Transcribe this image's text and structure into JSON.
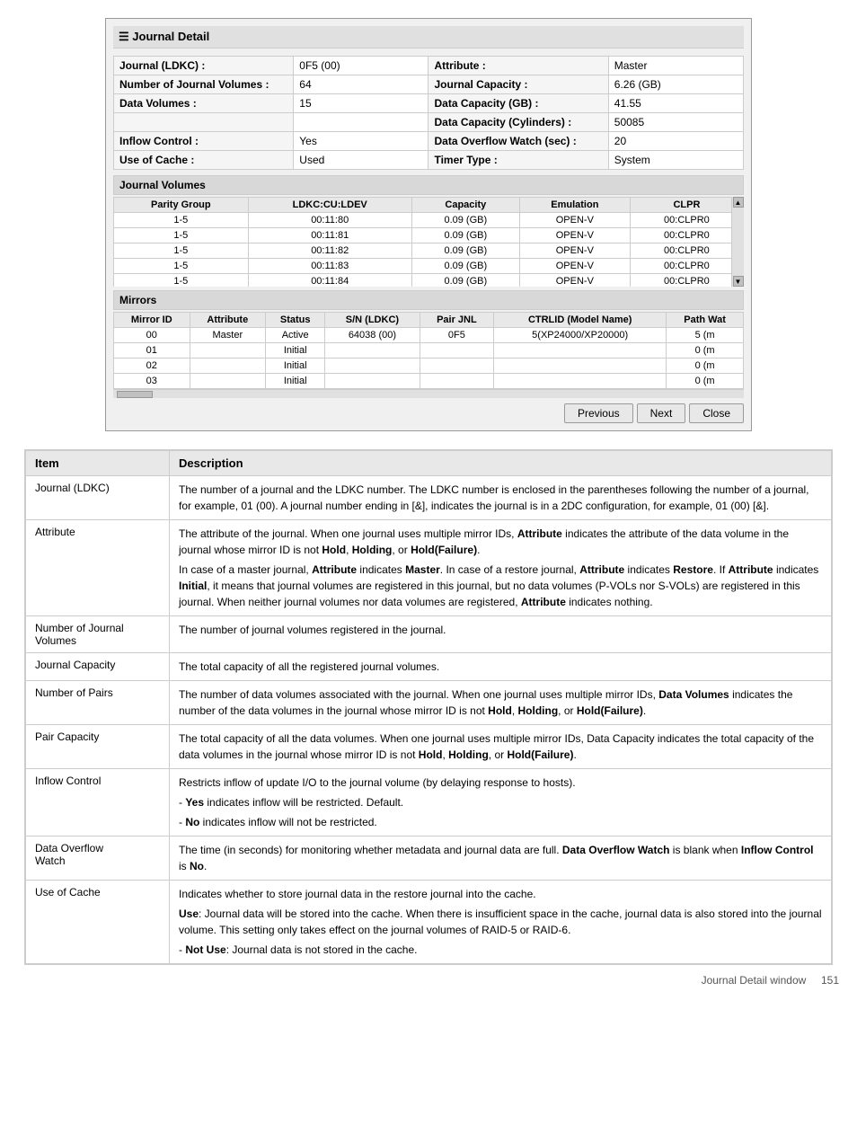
{
  "dialog": {
    "title": "Journal Detail",
    "fields": [
      {
        "label": "Journal (LDKC) :",
        "value": "0F5 (00)",
        "label2": "Attribute :",
        "value2": "Master"
      },
      {
        "label": "Number of Journal Volumes :",
        "value": "64",
        "label2": "Journal Capacity :",
        "value2": "6.26 (GB)"
      },
      {
        "label": "Data Volumes :",
        "value": "15",
        "label2": "Data Capacity (GB) :",
        "value2": "41.55"
      },
      {
        "label": "",
        "value": "",
        "label2": "Data Capacity (Cylinders) :",
        "value2": "50085"
      },
      {
        "label": "Inflow Control :",
        "value": "Yes",
        "label2": "Data Overflow Watch (sec) :",
        "value2": "20"
      },
      {
        "label": "Use of Cache :",
        "value": "Used",
        "label2": "Timer Type :",
        "value2": "System"
      }
    ],
    "journal_volumes_title": "Journal Volumes",
    "journal_volumes_headers": [
      "Parity Group",
      "LDKC:CU:LDEV",
      "Capacity",
      "Emulation",
      "CLPR"
    ],
    "journal_volumes_rows": [
      [
        "1-5",
        "00:11:80",
        "0.09 (GB)",
        "OPEN-V",
        "00:CLPR0"
      ],
      [
        "1-5",
        "00:11:81",
        "0.09 (GB)",
        "OPEN-V",
        "00:CLPR0"
      ],
      [
        "1-5",
        "00:11:82",
        "0.09 (GB)",
        "OPEN-V",
        "00:CLPR0"
      ],
      [
        "1-5",
        "00:11:83",
        "0.09 (GB)",
        "OPEN-V",
        "00:CLPR0"
      ],
      [
        "1-5",
        "00:11:84",
        "0.09 (GB)",
        "OPEN-V",
        "00:CLPR0"
      ]
    ],
    "mirrors_title": "Mirrors",
    "mirrors_headers": [
      "Mirror ID",
      "Attribute",
      "Status",
      "S/N (LDKC)",
      "Pair JNL",
      "CTRLID (Model Name)",
      "Path Wat"
    ],
    "mirrors_rows": [
      [
        "00",
        "Master",
        "Active",
        "64038 (00)",
        "0F5",
        "5(XP24000/XP20000)",
        "5 (m"
      ],
      [
        "01",
        "",
        "Initial",
        "",
        "",
        "",
        "0 (m"
      ],
      [
        "02",
        "",
        "Initial",
        "",
        "",
        "",
        "0 (m"
      ],
      [
        "03",
        "",
        "Initial",
        "",
        "",
        "",
        "0 (m"
      ]
    ],
    "buttons": [
      "Previous",
      "Next",
      "Close"
    ]
  },
  "doc_table": {
    "col_item": "Item",
    "col_desc": "Description",
    "rows": [
      {
        "item": "Journal (LDKC)",
        "desc_paragraphs": [
          "The number of a journal and the LDKC number. The LDKC number is enclosed in the parentheses following the number of a journal, for example, 01 (00). A journal number ending in [&], indicates the journal is in a 2DC configuration, for example, 01 (00) [&]."
        ]
      },
      {
        "item": "Attribute",
        "desc_paragraphs": [
          "The attribute of the journal. When one journal uses multiple mirror IDs, <b>Attribute</b> indicates the attribute of the data volume in the journal whose mirror ID is not <b>Hold</b>, <b>Holding</b>, or <b>Hold(Failure)</b>.",
          "In case of a master journal, <b>Attribute</b> indicates <b>Master</b>. In case of a restore journal, <b>Attribute</b> indicates <b>Restore</b>. If <b>Attribute</b> indicates <b>Initial</b>, it means that journal volumes are registered in this journal, but no data volumes (P-VOLs nor S-VOLs) are registered in this journal. When neither journal volumes nor data volumes are registered, <b>Attribute</b> indicates nothing."
        ]
      },
      {
        "item": "Number of Journal\nVolumes",
        "desc_paragraphs": [
          "The number of journal volumes registered in the journal."
        ]
      },
      {
        "item": "Journal Capacity",
        "desc_paragraphs": [
          "The total capacity of all the registered journal volumes."
        ]
      },
      {
        "item": "Number of Pairs",
        "desc_paragraphs": [
          "The number of data volumes associated with the journal. When one journal uses multiple mirror IDs, <b>Data Volumes</b> indicates the number of the data volumes in the journal whose mirror ID is not <b>Hold</b>, <b>Holding</b>, or <b>Hold(Failure)</b>."
        ]
      },
      {
        "item": "Pair Capacity",
        "desc_paragraphs": [
          "The total capacity of all the data volumes. When one journal uses multiple mirror IDs, Data Capacity indicates the total capacity of the data volumes in the journal whose mirror ID is not <b>Hold</b>, <b>Holding</b>, or <b>Hold(Failure)</b>."
        ]
      },
      {
        "item": "Inflow Control",
        "desc_paragraphs": [
          "Restricts inflow of update I/O to the journal volume (by delaying response to hosts).",
          "- <b>Yes</b> indicates inflow will be restricted. Default.",
          "- <b>No</b> indicates inflow will not be restricted."
        ]
      },
      {
        "item": "Data Overflow\nWatch",
        "desc_paragraphs": [
          "The time (in seconds) for monitoring whether metadata and journal data are full. <b>Data Overflow Watch</b> is blank when <b>Inflow Control</b> is <b>No</b>."
        ]
      },
      {
        "item": "Use of Cache",
        "desc_paragraphs": [
          "Indicates whether to store journal data in the restore journal into the cache.",
          "<b>Use</b>: Journal data will be stored into the cache. When there is insufficient space in the cache, journal data is also stored into the journal volume. This setting only takes effect on the journal volumes of RAID-5 or RAID-6.",
          "- <b>Not Use</b>: Journal data is not stored in the cache."
        ]
      }
    ]
  },
  "footer": {
    "text": "Journal Detail window",
    "page": "151"
  }
}
